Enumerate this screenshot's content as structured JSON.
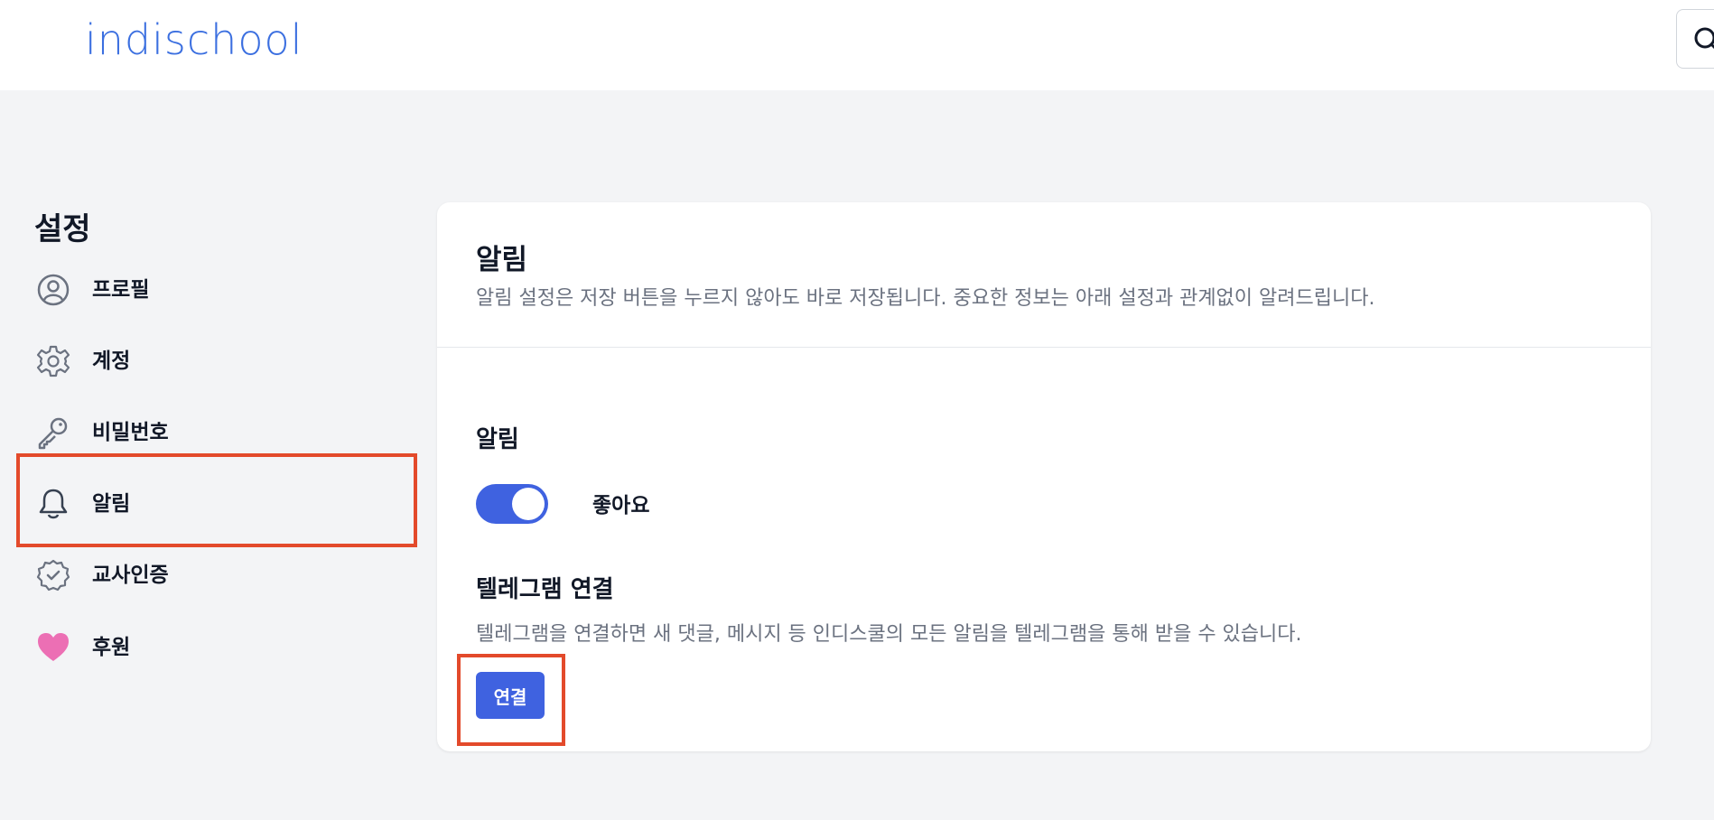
{
  "header": {
    "logo_text": "indischool"
  },
  "sidebar": {
    "title": "설정",
    "items": [
      {
        "label": "프로필",
        "icon": "user-circle-icon"
      },
      {
        "label": "계정",
        "icon": "gear-icon"
      },
      {
        "label": "비밀번호",
        "icon": "key-icon"
      },
      {
        "label": "알림",
        "icon": "bell-icon",
        "active": true
      },
      {
        "label": "교사인증",
        "icon": "badge-check-icon"
      },
      {
        "label": "후원",
        "icon": "heart-icon"
      }
    ]
  },
  "panel": {
    "title": "알림",
    "description": "알림 설정은 저장 버튼을 누르지 않아도 바로 저장됩니다. 중요한 정보는 아래 설정과 관계없이 알려드립니다.",
    "notifications": {
      "title": "알림",
      "toggle_label": "좋아요",
      "toggle_on": true
    },
    "telegram": {
      "title": "텔레그램 연결",
      "description": "텔레그램을 연결하면 새 댓글, 메시지 등 인디스쿨의 모든 알림을 텔레그램을 통해 받을 수 있습니다.",
      "connect_label": "연결"
    }
  },
  "colors": {
    "accent": "#3f62e0",
    "highlight": "#e34a2b",
    "heart": "#ec6fb4",
    "background": "#f3f4f6"
  }
}
